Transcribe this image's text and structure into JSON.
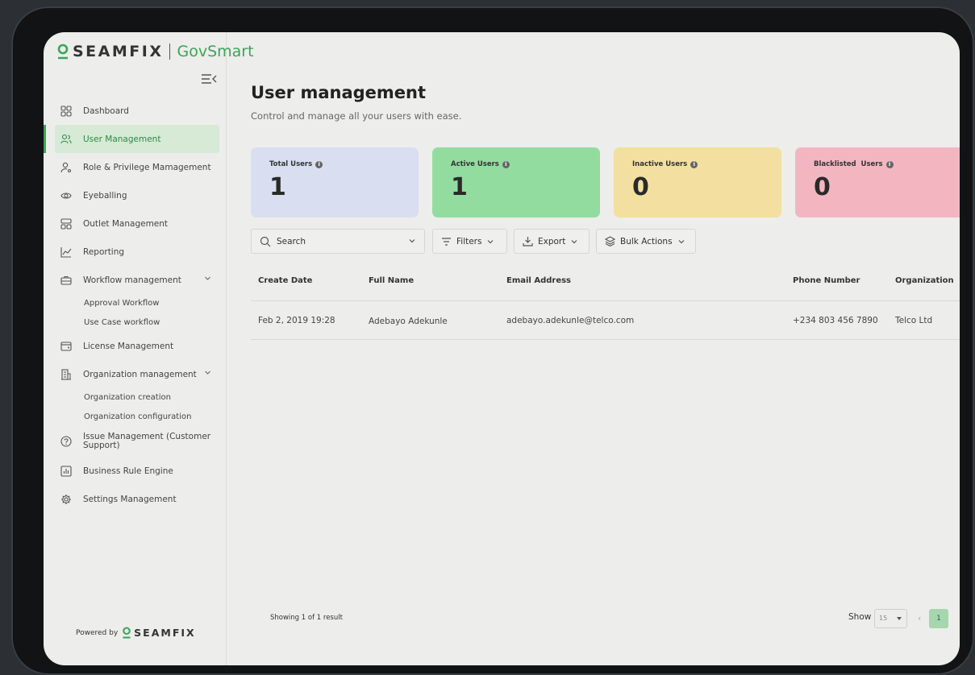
{
  "brand": {
    "name": "SEAMFIX",
    "product": "GovSmart"
  },
  "sidebar": {
    "items": [
      {
        "label": "Dashboard",
        "icon": "grid-icon"
      },
      {
        "label": "User Management",
        "icon": "users-icon",
        "active": true
      },
      {
        "label": "Role & Privilege Mamagement",
        "icon": "user-key-icon"
      },
      {
        "label": "Eyeballing",
        "icon": "eye-icon"
      },
      {
        "label": "Outlet Management",
        "icon": "outlet-icon"
      },
      {
        "label": "Reporting",
        "icon": "chart-line-icon"
      },
      {
        "label": "Workflow management",
        "icon": "briefcase-icon",
        "expanded": true,
        "children": [
          "Approval Workflow",
          "Use Case workflow"
        ]
      },
      {
        "label": "License Management",
        "icon": "license-icon"
      },
      {
        "label": "Organization management",
        "icon": "building-icon",
        "expanded": true,
        "children": [
          "Organization creation",
          "Organization configuration"
        ]
      },
      {
        "label": "Issue Management (Customer Support)",
        "icon": "help-circle-icon"
      },
      {
        "label": "Business Rule Engine",
        "icon": "bar-chart-icon"
      },
      {
        "label": "Settings Management",
        "icon": "gear-icon"
      }
    ],
    "powered_by": "Powered by",
    "powered_brand": "SEAMFIX"
  },
  "page": {
    "title": "User management",
    "subtitle": "Control and manage all your users with ease."
  },
  "stats": [
    {
      "label": "Total Users",
      "value": "1",
      "color": "#d9dff0"
    },
    {
      "label": "Active Users",
      "value": "1",
      "color": "#93dca0"
    },
    {
      "label": "Inactive Users",
      "value": "0",
      "color": "#f3e0a0"
    },
    {
      "label": "Blacklisted  Users",
      "value": "0",
      "color": "#f3b6c1"
    }
  ],
  "toolbar": {
    "search_placeholder": "Search",
    "filters_label": "Filters",
    "export_label": "Export",
    "bulk_label": "Bulk Actions"
  },
  "table": {
    "columns": [
      "Create Date",
      "Full Name",
      "Email Address",
      "Phone Number",
      "Organization"
    ],
    "rows": [
      [
        "Feb 2, 2019 19:28",
        "Adebayo Adekunle",
        "adebayo.adekunle@telco.com",
        "+234 803 456 7890",
        "Telco Ltd"
      ]
    ]
  },
  "pagination": {
    "summary": "Showing 1 of 1 result",
    "show_label": "Show",
    "page_size": "15",
    "prev_label": "‹",
    "current_page": "1"
  },
  "colors": {
    "accent": "#3aa655",
    "active_bg": "#d6ead6"
  }
}
